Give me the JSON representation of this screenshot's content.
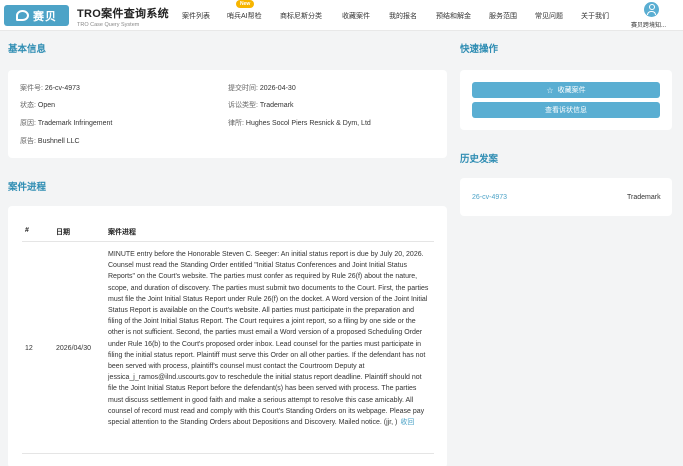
{
  "header": {
    "logo_text": "赛贝",
    "brand_title": "TRO案件查询系统",
    "brand_sub": "TRO Case Query System",
    "nav": [
      "案件列表",
      "哨兵AI帮检",
      "商标尼斯分类",
      "收藏案件",
      "我的报名",
      "预结和解金",
      "服务范围",
      "常见问题",
      "关于我们"
    ],
    "new_badge": "New",
    "user_name": "赛贝跨境知..."
  },
  "basic_info": {
    "section_title": "基本信息",
    "case_no_label": "案件号:",
    "case_no": "26-cv-4973",
    "submit_label": "提交时间:",
    "submit_date": "2026-04-30",
    "status_label": "状态:",
    "status": "Open",
    "type_label": "诉讼类型:",
    "type": "Trademark",
    "cause_label": "原因:",
    "cause": "Trademark Infringement",
    "lawyer_label": "律所:",
    "lawyer": "Hughes Socol Piers Resnick & Dym, Ltd",
    "plaintiff_label": "原告:",
    "plaintiff": "Bushnell LLC"
  },
  "quick_actions": {
    "section_title": "快速操作",
    "favorite_label": "收藏案件",
    "view_complaint_label": "查看诉状信息"
  },
  "history": {
    "section_title": "历史发案",
    "items": [
      {
        "case_no": "26-cv-4973",
        "type": "Trademark"
      }
    ]
  },
  "progress": {
    "section_title": "案件进程",
    "columns": [
      "#",
      "日期",
      "案件进程"
    ],
    "rows": [
      {
        "num": "12",
        "date": "2026/04/30",
        "text": "MINUTE entry before the Honorable Steven C. Seeger: An initial status report is due by July 20, 2026. Counsel must read the Standing Order entitled \"Initial Status Conferences and Joint Initial Status Reports\" on the Court's website. The parties must confer as required by Rule 26(f) about the nature, scope, and duration of discovery. The parties must submit two documents to the Court. First, the parties must file the Joint Initial Status Report under Rule 26(f) on the docket. A Word version of the Joint Initial Status Report is available on the Court's website. All parties must participate in the preparation and filing of the Joint Initial Status Report. The Court requires a joint report, so a filing by one side or the other is not sufficient. Second, the parties must email a Word version of a proposed Scheduling Order under Rule 16(b) to the Court's proposed order inbox. Lead counsel for the parties must participate in filing the initial status report. Plaintiff must serve this Order on all other parties. If the defendant has not been served with process, plaintiff's counsel must contact the Courtroom Deputy at jessica_j_ramos@ilnd.uscourts.gov to reschedule the initial status report deadline. Plaintiff should not file the Joint Initial Status Report before the defendant(s) has been served with process. The parties must discuss settlement in good faith and make a serious attempt to resolve this case amicably. All counsel of record must read and comply with this Court's Standing Orders on its webpage. Please pay special attention to the Standing Orders about Depositions and Discovery. Mailed notice. (jjr, )",
        "fold_label": "收回"
      }
    ]
  }
}
